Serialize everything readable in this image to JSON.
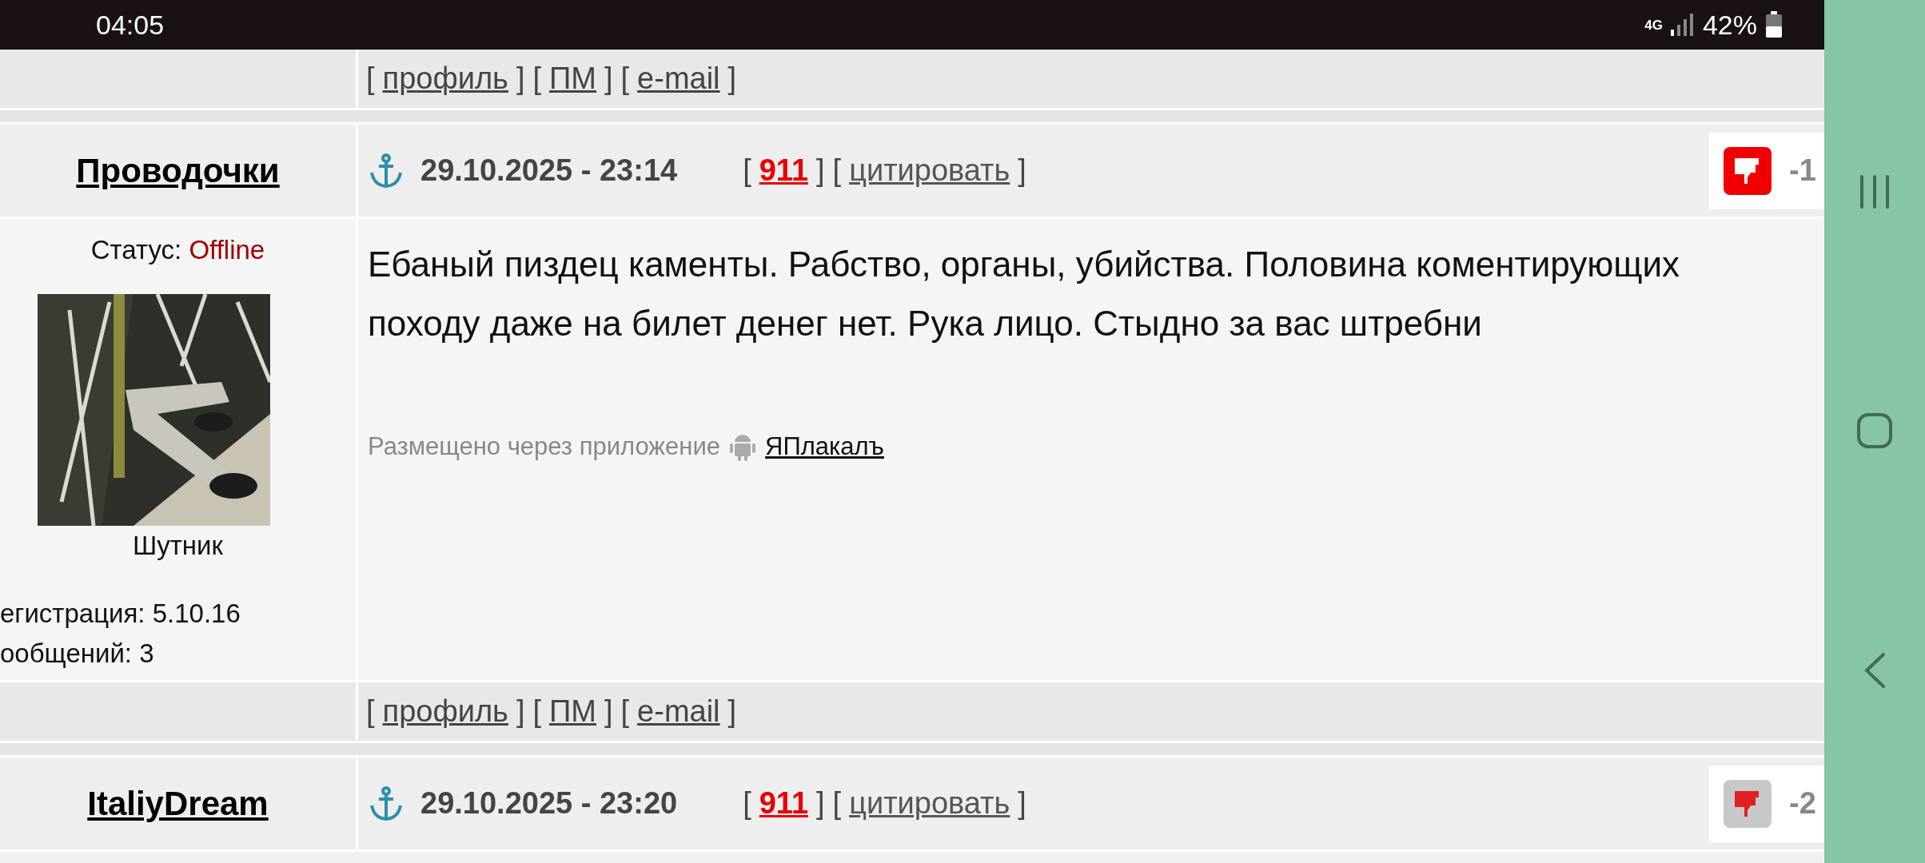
{
  "status_bar": {
    "time": "04:05",
    "network": "4G",
    "battery": "42%"
  },
  "brackets": [
    "[",
    "]"
  ],
  "top_links": [
    "профиль",
    "ПМ",
    "e-mail"
  ],
  "posts": [
    {
      "author": "Проводочки",
      "date": "29.10.2025 - 23:14",
      "report": "911",
      "quote": "цитировать",
      "rating": {
        "value": "-1",
        "active": true
      },
      "status_label": "Статус:",
      "status": "Offline",
      "rank": "Шутник",
      "registration": "егистрация: 5.10.16",
      "messages": "ообщений: 3",
      "text": "Ебаный пиздец каменты. Рабство, органы, убийства. Половина коментирующих походу даже на билет денег нет. Рука лицо. Стыдно за вас штребни",
      "via": "Размещено через приложение",
      "app": "ЯПлакалъ",
      "links": [
        "профиль",
        "ПМ",
        "e-mail"
      ]
    },
    {
      "author": "ItaliyDream",
      "date": "29.10.2025 - 23:20",
      "report": "911",
      "quote": "цитировать",
      "rating": {
        "value": "-2",
        "active": false
      }
    }
  ]
}
